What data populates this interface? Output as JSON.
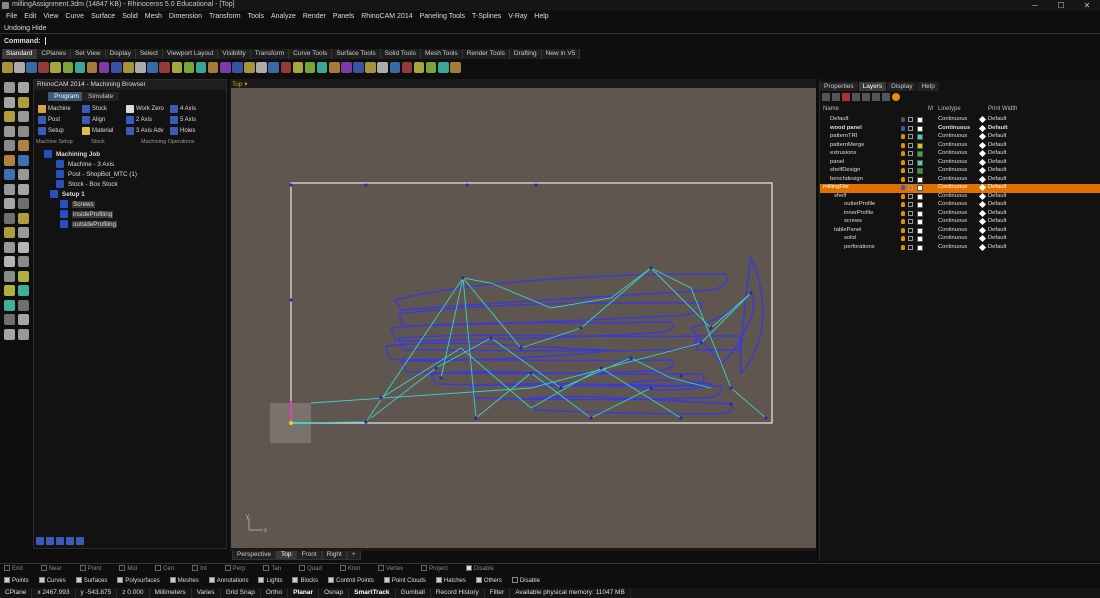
{
  "window": {
    "title": "millingAssignment.3dm (14847 KB) - Rhinoceros 5.0 Educational - [Top]",
    "controls": [
      "─",
      "☐",
      "✕"
    ]
  },
  "menu": [
    "File",
    "Edit",
    "View",
    "Curve",
    "Surface",
    "Solid",
    "Mesh",
    "Dimension",
    "Transform",
    "Tools",
    "Analyze",
    "Render",
    "Panels",
    "RhinoCAM 2014",
    "Paneling Tools",
    "T-Splines",
    "V-Ray",
    "Help"
  ],
  "command": {
    "history": "Undoing Hide",
    "prompt": "Command:"
  },
  "toolbar_tabs": [
    "Standard",
    "CPlanes",
    "Set View",
    "Display",
    "Select",
    "Viewport Layout",
    "Visibility",
    "Transform",
    "Curve Tools",
    "Surface Tools",
    "Solid Tools",
    "Mesh Tools",
    "Render Tools",
    "Drafting",
    "New in V5"
  ],
  "rhinocam": {
    "title": "RhinoCAM 2014 - Machining Browser",
    "tabs": [
      "Program",
      "Simulate"
    ],
    "buttons": [
      "Machine",
      "Stock",
      "Work Zero",
      "4 Axis",
      "Post",
      "Align",
      "2 Axis",
      "5 Axis",
      "Setup",
      "Material",
      "3 Axis Adv",
      "Holes"
    ],
    "groups": [
      "Machine Setup",
      "Stock",
      "Machining Operations"
    ],
    "tree": [
      {
        "label": "Machining Job"
      },
      {
        "label": "Machine - 3 Axis"
      },
      {
        "label": "Post - ShopBot_MTC (1)"
      },
      {
        "label": "Stock - Box Stock"
      },
      {
        "label": "Setup 1"
      },
      {
        "label": "Screws"
      },
      {
        "label": "insideProfiling"
      },
      {
        "label": "outsideProfiling"
      }
    ]
  },
  "viewport": {
    "name": "Top",
    "tabs": [
      "Perspective",
      "Top",
      "Front",
      "Right"
    ],
    "axis_y": "y",
    "axis_x": "x"
  },
  "right_panel": {
    "tabs": [
      "Properties",
      "Layers",
      "Display",
      "Help"
    ],
    "columns": [
      "Name",
      "M",
      "Linetype",
      "Print Width"
    ],
    "layers": [
      {
        "name": "Default",
        "color": "#ffffff",
        "linetype": "Continuous",
        "width": "Default"
      },
      {
        "name": "wood panel",
        "color": "#ffffff",
        "linetype": "Continuous",
        "width": "Default",
        "bold": true
      },
      {
        "name": "patternTRI",
        "color": "#3fd0d0",
        "linetype": "Continuous",
        "width": "Default"
      },
      {
        "name": "patternMerge",
        "color": "#d0d000",
        "linetype": "Continuous",
        "width": "Default"
      },
      {
        "name": "extrusions",
        "color": "#2fb02f",
        "linetype": "Continuous",
        "width": "Default"
      },
      {
        "name": "panel",
        "color": "#4fd0c0",
        "linetype": "Continuous",
        "width": "Default"
      },
      {
        "name": "shelfDesign",
        "color": "#22aa22",
        "linetype": "Continuous",
        "width": "Default"
      },
      {
        "name": "benchdesign",
        "color": "#ffffff",
        "linetype": "Continuous",
        "width": "Default"
      },
      {
        "name": "millingFile",
        "color": "#ffffff",
        "linetype": "Continuous",
        "width": "Default",
        "current": true
      },
      {
        "name": "shelf",
        "color": "#ffffff",
        "linetype": "Continuous",
        "width": "Default"
      },
      {
        "name": "outterProfile",
        "color": "#ffffff",
        "linetype": "Continuous",
        "width": "Default"
      },
      {
        "name": "innerProfile",
        "color": "#ffffff",
        "linetype": "Continuous",
        "width": "Default"
      },
      {
        "name": "screws",
        "color": "#ffffff",
        "linetype": "Continuous",
        "width": "Default"
      },
      {
        "name": "tablePanel",
        "color": "#ffffff",
        "linetype": "Continuous",
        "width": "Default"
      },
      {
        "name": "solid",
        "color": "#ffffff",
        "linetype": "Continuous",
        "width": "Default"
      },
      {
        "name": "perforations",
        "color": "#ffffff",
        "linetype": "Continuous",
        "width": "Default"
      }
    ]
  },
  "osnap": [
    "End",
    "Near",
    "Point",
    "Mid",
    "Cen",
    "Int",
    "Perp",
    "Tan",
    "Quad",
    "Knot",
    "Vertex",
    "Project",
    "Disable"
  ],
  "filter": [
    "Points",
    "Curves",
    "Surfaces",
    "Polysurfaces",
    "Meshes",
    "Annotations",
    "Lights",
    "Blocks",
    "Control Points",
    "Point Clouds",
    "Hatches",
    "Others",
    "Disable"
  ],
  "status": [
    "CPlane",
    "x 2467.993",
    "y -543.875",
    "z 0.000",
    "Millimeters",
    "Varies",
    "Grid Snap",
    "Ortho",
    "Planar",
    "Osnap",
    "SmartTrack",
    "Gumball",
    "Record History",
    "Filter",
    "Available physical memory: 11047 MB"
  ],
  "colors": {
    "viewport_bg": "#5f564f",
    "current_layer": "#e07000",
    "curve_blue": "#3a3ad8",
    "curve_cyan": "#3fd0c8",
    "selection": "#3f5a7a"
  }
}
